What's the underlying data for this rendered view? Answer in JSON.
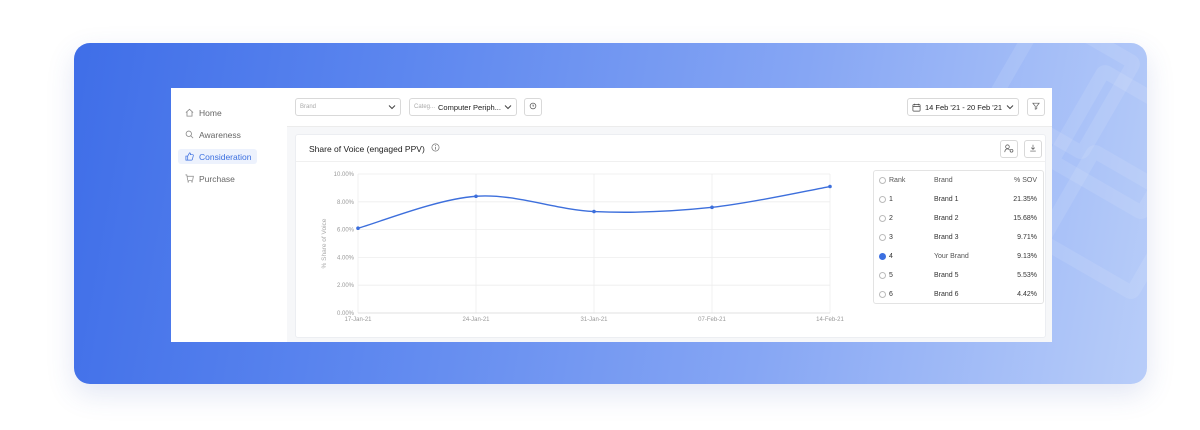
{
  "sidebar": {
    "items": [
      {
        "label": "Home",
        "icon": "home-icon",
        "active": false
      },
      {
        "label": "Awareness",
        "icon": "search-icon",
        "active": false
      },
      {
        "label": "Consideration",
        "icon": "thumbs-up-icon",
        "active": true
      },
      {
        "label": "Purchase",
        "icon": "cart-icon",
        "active": false
      }
    ]
  },
  "toolbar": {
    "brand_placeholder": "Brand",
    "category_prefix": "Categ...",
    "category_value": "Computer Periph...",
    "date_range": "14 Feb '21 - 20 Feb '21"
  },
  "card": {
    "title": "Share of Voice (engaged PPV)"
  },
  "table": {
    "headers": {
      "rank": "Rank",
      "brand": "Brand",
      "sov": "% SOV"
    },
    "rows": [
      {
        "rank": "1",
        "brand": "Brand 1",
        "sov": "21.35%",
        "selected": false
      },
      {
        "rank": "2",
        "brand": "Brand 2",
        "sov": "15.68%",
        "selected": false
      },
      {
        "rank": "3",
        "brand": "Brand 3",
        "sov": "9.71%",
        "selected": false
      },
      {
        "rank": "4",
        "brand": "Your Brand",
        "sov": "9.13%",
        "selected": true
      },
      {
        "rank": "5",
        "brand": "Brand 5",
        "sov": "5.53%",
        "selected": false
      },
      {
        "rank": "6",
        "brand": "Brand 6",
        "sov": "4.42%",
        "selected": false
      }
    ]
  },
  "colors": {
    "accent": "#3b6fe0",
    "line": "#3d6fdc"
  },
  "chart_data": {
    "type": "line",
    "title": "Share of Voice (engaged PPV)",
    "xlabel": "",
    "ylabel": "% Share of Voice",
    "x": [
      "17-Jan-21",
      "24-Jan-21",
      "31-Jan-21",
      "07-Feb-21",
      "14-Feb-21"
    ],
    "series": [
      {
        "name": "Your Brand",
        "values": [
          6.1,
          8.4,
          7.3,
          7.6,
          9.1
        ]
      }
    ],
    "yticks": [
      "0.00%",
      "2.00%",
      "4.00%",
      "6.00%",
      "8.00%",
      "10.00%"
    ],
    "ylim": [
      0,
      10
    ],
    "grid": true
  }
}
